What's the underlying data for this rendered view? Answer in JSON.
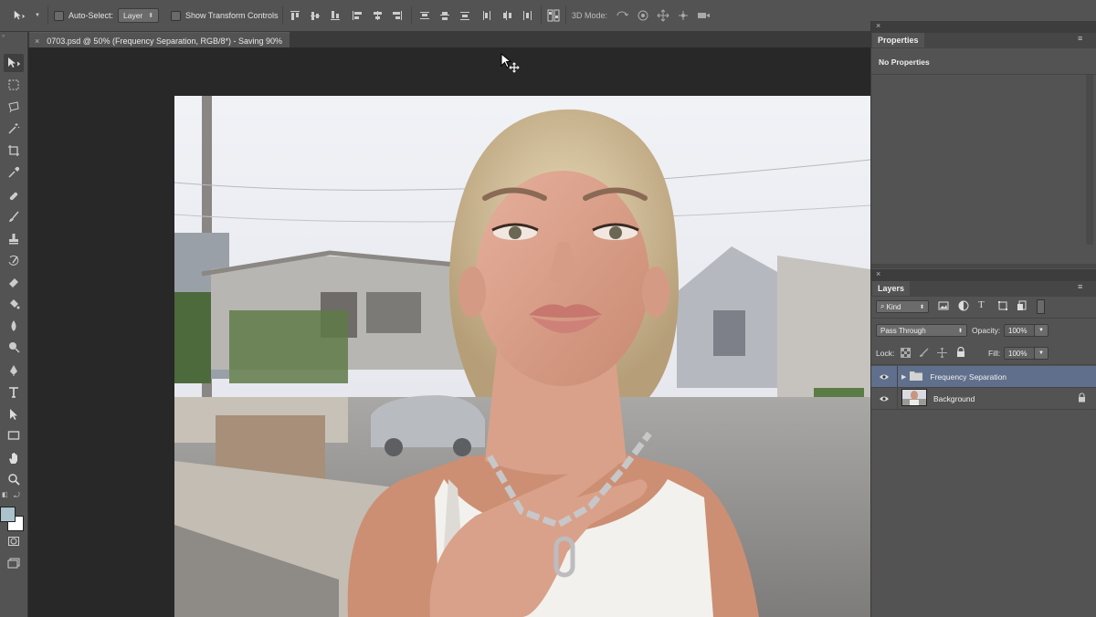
{
  "options_bar": {
    "auto_select_label": "Auto-Select:",
    "auto_select_value": "Layer",
    "show_transform_label": "Show Transform Controls",
    "mode_3d_label": "3D Mode:"
  },
  "document": {
    "tab_title": "0703.psd @ 50% (Frequency Separation, RGB/8*) - Saving 90%",
    "close_glyph": "×"
  },
  "properties_panel": {
    "tab_label": "Properties",
    "content": "No Properties"
  },
  "layers_panel": {
    "tab_label": "Layers",
    "filter_kind": "Kind",
    "blend_mode": "Pass Through",
    "opacity_label": "Opacity:",
    "opacity_value": "100%",
    "lock_label": "Lock:",
    "fill_label": "Fill:",
    "fill_value": "100%",
    "layers": [
      {
        "name": "Frequency Separation",
        "type": "group",
        "visible": true,
        "selected": true
      },
      {
        "name": "Background",
        "type": "image",
        "visible": true,
        "locked": true,
        "selected": false
      }
    ]
  },
  "colors": {
    "foreground": "#a9c2cb",
    "background": "#ffffff",
    "selected_layer": "#5f6f8c",
    "panel_bg": "#535353"
  },
  "tools": [
    "move-tool-icon",
    "marquee-tool-icon",
    "lasso-tool-icon",
    "magic-wand-icon",
    "crop-tool-icon",
    "eyedropper-icon",
    "healing-brush-icon",
    "brush-tool-icon",
    "clone-stamp-icon",
    "history-brush-icon",
    "eraser-icon",
    "paint-bucket-icon",
    "blur-tool-icon",
    "dodge-tool-icon",
    "pen-tool-icon",
    "type-tool-icon",
    "path-selection-icon",
    "rectangle-tool-icon",
    "hand-tool-icon",
    "zoom-tool-icon",
    "quick-mask-icon",
    "screen-mode-icon"
  ]
}
